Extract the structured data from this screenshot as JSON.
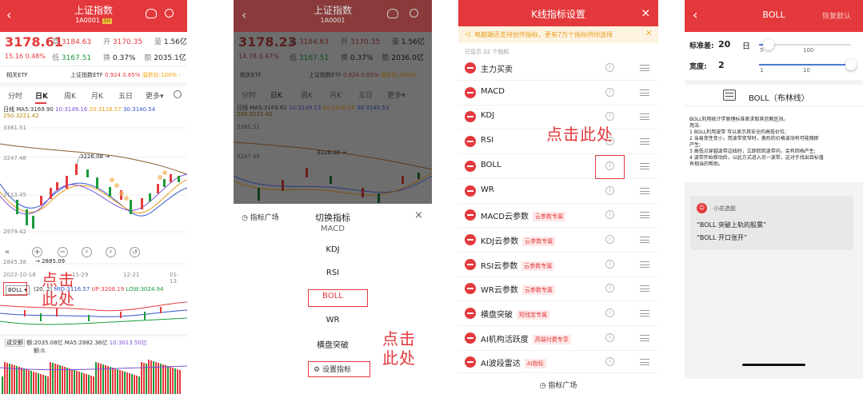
{
  "panel1": {
    "title": "上证指数",
    "code": "1A0001",
    "code_badge": "SH",
    "price": "3178.61",
    "stats_row1": [
      {
        "label": "高",
        "value": "3184.63"
      },
      {
        "label": "开",
        "value": "3170.35"
      },
      {
        "label": "量",
        "value": "1.56亿"
      }
    ],
    "change": "15.16",
    "change_pct": "0.48%",
    "stats_row2": [
      {
        "label": "低",
        "value": "3167.51"
      },
      {
        "label": "换",
        "value": "0.37%"
      },
      {
        "label": "额",
        "value": "2035.1亿"
      }
    ],
    "etf_label": "相关ETF",
    "etf_name": "上证指数ETF",
    "etf_price": "0.924",
    "etf_pct": "0.65%",
    "etf_extra": "溢折价:100%",
    "tabs": [
      "分时",
      "日K",
      "周K",
      "月K",
      "五日",
      "更多▾"
    ],
    "ma_line": [
      {
        "label": "日线",
        "color": "#222222"
      },
      {
        "label": "MA5:3169.90",
        "color": "#333333"
      },
      {
        "label": "10:3149.16",
        "color": "#7a4fd6"
      },
      {
        "label": "20:3116.57",
        "color": "#e89a1a"
      },
      {
        "label": "30:3140.54",
        "color": "#3355cc"
      }
    ],
    "ma_line2": "250:3221.42",
    "y_labels": [
      "3381.51",
      "3247.48",
      "3113.45",
      "2979.42",
      "2845.38"
    ],
    "high_mark": "3226.08",
    "low_mark": "2885.09",
    "dates": [
      "2022-10-18",
      "11-29",
      "12-21",
      "01-13"
    ],
    "boll_button": "BOLL",
    "boll_line": [
      {
        "label": "(20, 2)",
        "color": "#333333"
      },
      {
        "label": "MID:3116.57",
        "color": "#3355cc"
      },
      {
        "label": "UP:3208.19",
        "color": "#e4393c"
      },
      {
        "label": "LOW:3024.94",
        "color": "#1a9b3a"
      }
    ],
    "vol_label": "成交额",
    "vol_line": [
      {
        "label": "额:2035.08亿",
        "color": "#333333"
      },
      {
        "label": "MA5:2882.36亿",
        "color": "#333333"
      },
      {
        "label": "10:3013.50亿",
        "color": "#7a4fd6"
      }
    ],
    "vol_sub": "额:0.",
    "annotation": "点击此处"
  },
  "panel2": {
    "title": "上证指数",
    "code": "1A0001",
    "price": "3178.23",
    "stats_row1": [
      {
        "label": "高",
        "value": "3184.63"
      },
      {
        "label": "开",
        "value": "3170.35"
      },
      {
        "label": "量",
        "value": "1.56亿"
      }
    ],
    "change": "14.78",
    "change_pct": "0.47%",
    "stats_row2": [
      {
        "label": "低",
        "value": "3167.51"
      },
      {
        "label": "换",
        "value": "0.37%"
      },
      {
        "label": "额",
        "value": "2036.0亿"
      }
    ],
    "etf_label": "相关ETF",
    "etf_name": "上证指数ETF",
    "etf_price": "0.924",
    "etf_pct": "0.65%",
    "etf_extra": "溢折价:100%",
    "tabs": [
      "分时",
      "日K",
      "周K",
      "月K",
      "五日",
      "更多▾"
    ],
    "ma_line": [
      {
        "label": "日线",
        "color": "#dddddd"
      },
      {
        "label": "MA5:3169.82",
        "color": "#dddddd"
      },
      {
        "label": "10:3149.13",
        "color": "#b79bff"
      },
      {
        "label": "20:3116.55",
        "color": "#e89a1a"
      },
      {
        "label": "30:3140.53",
        "color": "#8fa6ff"
      }
    ],
    "ma_line2": "250:3221.42",
    "y_labels": [
      "3381.51",
      "3247.48"
    ],
    "high_mark": "3226.08",
    "sheet_left": "指标广场",
    "sheet_title": "切换指标",
    "sheet_close": "×",
    "options": [
      "MACD",
      "KDJ",
      "RSI",
      "BOLL",
      "WR",
      "横盘突破"
    ],
    "settings_button": "设置指标",
    "annotation": "点击此处"
  },
  "panel3": {
    "title": "K线指标设置",
    "close": "×",
    "notice": "电脑端还支持创作指标，更有7万个指标供你选择",
    "notice_close": "×",
    "count": "已显示 22 个指标",
    "rows": [
      {
        "label": "主力买卖",
        "tag": ""
      },
      {
        "label": "MACD",
        "tag": ""
      },
      {
        "label": "KDJ",
        "tag": ""
      },
      {
        "label": "RSI",
        "tag": ""
      },
      {
        "label": "BOLL",
        "tag": ""
      },
      {
        "label": "WR",
        "tag": ""
      },
      {
        "label": "MACD云参数",
        "tag": "云参数专属"
      },
      {
        "label": "KDJ云参数",
        "tag": "云参数专属"
      },
      {
        "label": "RSI云参数",
        "tag": "云参数专属"
      },
      {
        "label": "WR云参数",
        "tag": "云参数专属"
      },
      {
        "label": "横盘突破",
        "tag": "短线宝专属"
      },
      {
        "label": "AI机构活跃度",
        "tag": "高端付费专享"
      },
      {
        "label": "AI波段雷达",
        "tag": "AI指标"
      }
    ],
    "footer": "指标广场",
    "annotation": "点击此处"
  },
  "panel4": {
    "title": "BOLL",
    "reset": "恢复默认",
    "param1_label": "标准差:",
    "param1_value": "20",
    "param1_unit": "日",
    "param1_ticks": [
      "5",
      "100"
    ],
    "param1_level": 15,
    "param2_label": "宽度:",
    "param2_value": "2",
    "param2_ticks": [
      "1",
      "10"
    ],
    "param2_level": 11,
    "name": "BOLL（布林线）",
    "desc": [
      "BOLL利用统计学原理标准差求取其信赖区间。",
      "用法:",
      "1  BOLL利用波带 可以显示其安全的高低价位;",
      "2  当易变性变小，而波带变窄时，激烈的价格波动有可能随即",
      "产生;",
      "3  高低点穿越波带边线时，立即回到波带内，会有回档产生;",
      "4  波带开始移动后，以此方式进入另一波带，这对于找出目标值",
      "有相当的帮助。"
    ],
    "assistant_name": "小花选股",
    "suggestions": [
      "“BOLL 突破上轨的股票”",
      "“BOLL 开口张开”"
    ]
  }
}
